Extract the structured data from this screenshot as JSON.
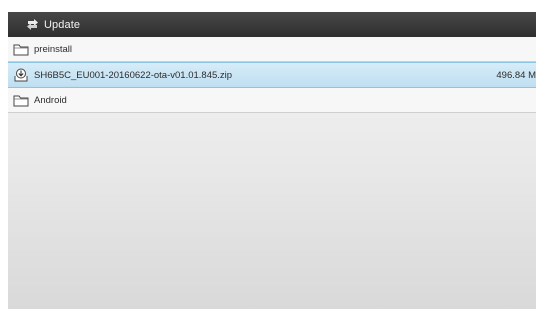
{
  "app": {
    "title": "Update",
    "icon": "refresh-arrows-icon"
  },
  "files": [
    {
      "name": "preinstall",
      "size": "",
      "icon": "folder-icon",
      "selected": false
    },
    {
      "name": "SH6B5C_EU001-20160622-ota-v01.01.845.zip",
      "size": "496.84 M",
      "icon": "download-package-icon",
      "selected": true
    },
    {
      "name": "Android",
      "size": "",
      "icon": "folder-icon",
      "selected": false
    }
  ],
  "colors": {
    "titlebar": "#3b3b3b",
    "selected_row": "#cbe6f5",
    "selected_border": "#8cc6e6",
    "text": "#2c2c2c"
  }
}
